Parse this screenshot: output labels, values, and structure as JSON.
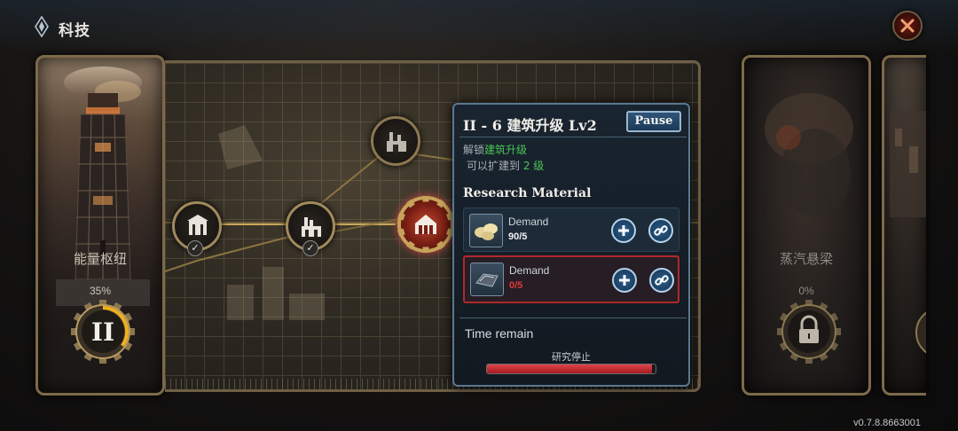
{
  "topbar": {
    "title": "科技",
    "brand_icon": "diamond-emblem-icon",
    "close_icon": "close-icon"
  },
  "left_card": {
    "name": "能量枢纽",
    "progress_text": "35%",
    "progress": 0.35,
    "tier_label": "II",
    "image": "tower-illustration"
  },
  "tree": {
    "nodes": [
      {
        "name": "tree-node-1",
        "state": "completed",
        "icon": "building-icon"
      },
      {
        "name": "tree-node-2",
        "state": "completed",
        "icon": "factory-icon"
      },
      {
        "name": "tree-node-3",
        "state": "locked",
        "icon": "factory-icon"
      },
      {
        "name": "tree-node-4",
        "state": "researching",
        "icon": "house-icon"
      }
    ],
    "check_glyph": "✓"
  },
  "popup": {
    "title": "II - 6 建筑升级 Lv2",
    "pause_label": "Pause",
    "unlock_prefix": "解锁",
    "unlock_item": "建筑升级",
    "expand_prefix": "可以扩建到 ",
    "expand_level": "2 级",
    "section_title": "Research Material",
    "materials": [
      {
        "demand_label": "Demand",
        "count": "90/5",
        "icon": "bread-icon",
        "sufficient": true
      },
      {
        "demand_label": "Demand",
        "count": "0/5",
        "icon": "metal-ingot-icon",
        "sufficient": false
      }
    ],
    "time_label": "Time remain",
    "status": "研究停止",
    "progress": 0.98
  },
  "right_cards": [
    {
      "name": "蒸汽悬梁",
      "progress_text": "0%",
      "locked": true
    },
    {
      "name": "",
      "progress_text": "",
      "locked": true
    }
  ],
  "version": "v0.7.8.8663001",
  "colors": {
    "accent_green": "#4cc454",
    "warning_red": "#b0282c",
    "gold_border": "#a08a5c"
  }
}
